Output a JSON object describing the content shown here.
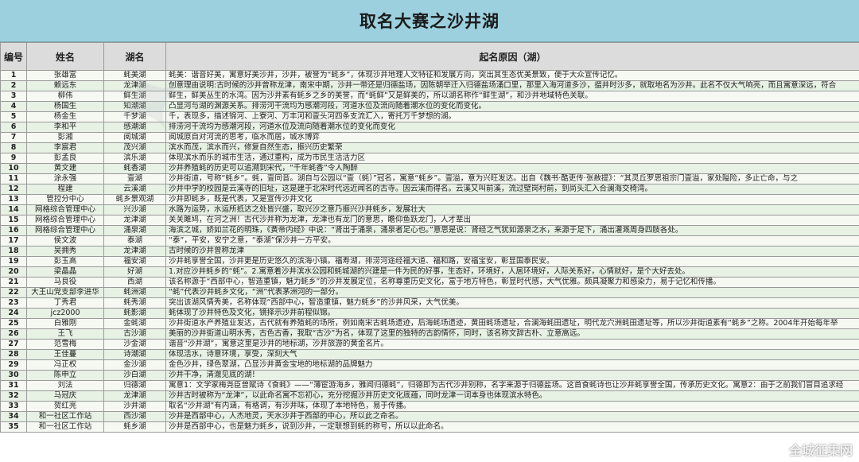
{
  "title": "取名大赛之沙井湖",
  "headers": {
    "no": "编号",
    "name": "姓名",
    "lake": "湖名",
    "reason": "起名原因（湖）"
  },
  "rows": [
    {
      "no": "1",
      "name": "张雄富",
      "lake": "蚝美湖",
      "reason": "蚝美：谐音好美，寓意好美沙井，沙井，被誉为“蚝乡”，体现沙井地理人文特征和发展方向，突出其生态优美景致，便于大众宣传记忆。"
    },
    {
      "no": "2",
      "name": "赖远东",
      "lake": "龙津湖",
      "reason": "创意理由说明:古时候的沙井曾称龙津，南宋中期，沙井一带还是归德盐场，因陈朝举迁入归德盐场涌口里，那里入海河道多沙，搵井时沙多，就取地名为沙井。此名不仅大气响亮，而且寓意深远，符合"
    },
    {
      "no": "3",
      "name": "柳伟",
      "lake": "鲜生湖",
      "reason": "鲜生，鲜美丛生的水湾。因为沙井素有蚝乡之乡的美誉，而“蚝鲜”又是鲜美的，所以湖名称作“鲜生湖”，和沙井地域特色关联。"
    },
    {
      "no": "4",
      "name": "杨国生",
      "lake": "知潮湖",
      "reason": "凸显河与湖的渊源关系。排涝河干流均为感潮河段，河道水位及流向随着潮水位的变化而变化。"
    },
    {
      "no": "5",
      "name": "杨金生",
      "lake": "千梦湖",
      "reason": "千，表现多，描述锦河、上寮河、万丰河和壹头河四条支流汇入，寄托万千梦想的湖。"
    },
    {
      "no": "6",
      "name": "李和平",
      "lake": "感潮湖",
      "reason": "排涝河干流均为感潮河段，河道水位及流向随着潮水位的变化而变化"
    },
    {
      "no": "7",
      "name": "彭湘",
      "lake": "阅城湖",
      "reason": "阅城原自对河流的思考，临水而居，城水博弈"
    },
    {
      "no": "8",
      "name": "李宸君",
      "lake": "茂兴湖",
      "reason": "滨水而茂，滨水而兴，修复自然生态，振兴历史繁荣"
    },
    {
      "no": "9",
      "name": "彭孟良",
      "lake": "滨乐湖",
      "reason": "体现滨水而乐的城市生活，通过重构，成为市民生活活力区"
    },
    {
      "no": "10",
      "name": "黄文建",
      "lake": "蚝香湖",
      "reason": "沙井养殖蚝的历史可以追溯到宋代，“千年蚝香”令人陶醉"
    },
    {
      "no": "11",
      "name": "涂永强",
      "lake": "壹湖",
      "reason": "沙井街道，号称“蚝乡”。蚝，壹同音。湖自与公园以“壹（蚝）”冠名，寓意“蚝乡”。壹溢，意为兴旺发达。出自《魏书·酷吏传·张赦提》：“其灵丘罗思祖宗门壹溢，家处隘险，多止亡命，与之"
    },
    {
      "no": "12",
      "name": "程建",
      "lake": "云溪湖",
      "reason": "沙井中学的校园是云溪寺的旧址，这是建于北宋时代远近闻名的古寺。因云溪而得名。云溪又叫前溪，流过壁岗村前，到尚头汇入合澜海交椅湾。"
    },
    {
      "no": "13",
      "name": "管控分中心",
      "lake": "蚝乡景观湖",
      "reason": "沙井即蚝乡，既是代表，又是宣传沙井文化"
    },
    {
      "no": "14",
      "name": "网格综合管理中心",
      "lake": "兴沙湖",
      "reason": "水路为运势，水运所抵达之处皆兴盛，取兴沙之意乃振兴沙井蚝乡，发展壮大"
    },
    {
      "no": "15",
      "name": "网格综合管理中心",
      "lake": "龙津湖",
      "reason": "关关雎鸠，在河之洲！古代沙井称为龙津，龙津也有龙门的意思，瞻仰鱼跃龙门，人才辈出"
    },
    {
      "no": "16",
      "name": "网格综合管理中心",
      "lake": "涌泉湖",
      "reason": "海滨之城，娇如兰花的明珠，《黄帝内经》中说：“肾出于涌泉，涌泉者足心也。”意思是说：肾经之气犹如源泉之水，来源于足下，涌出灌溉周身四肢各处。"
    },
    {
      "no": "17",
      "name": "侯文波",
      "lake": "泰湖",
      "reason": "“泰”，平安，安宁之意，“泰湖”保沙井一方平安。"
    },
    {
      "no": "18",
      "name": "吴拥秀",
      "lake": "龙津湖",
      "reason": "古时候的沙井曾称龙津"
    },
    {
      "no": "19",
      "name": "彭玉高",
      "lake": "福安湖",
      "reason": "沙井蚝享誉全国，沙井更是历史悠久的滨海小镇。福寿湖，排涝河途经福大道、福和路，安福宝安，彰显国泰民安。"
    },
    {
      "no": "20",
      "name": "梁晶晶",
      "lake": "好湖",
      "reason": "1.对应沙井蚝乡的“蚝”。2.寓意着沙井滨水公园和蚝城湖的兴建是一件为民的好事，生态好，环境好，人居环境好，人际关系好，心情就好，是个大好去处。"
    },
    {
      "no": "21",
      "name": "马良役",
      "lake": "西湖",
      "reason": "该名称源于“西部中心，智造重镇，魅力蚝乡”的沙井发展定位，名称尊重历史文化，富于地方特色，彰显时代感，大气优雅。颇具凝聚力和感染力，易于记忆和传播。"
    },
    {
      "no": "22",
      "name": "大王山党支部李进华",
      "lake": "蚝洲湖",
      "reason": "“蚝”代表沙井蚝乡文化，“洲”代表茅洲河的一部分。"
    },
    {
      "no": "23",
      "name": "丁秀君",
      "lake": "蚝秀湖",
      "reason": "突出该湖风情秀美，名称体现“西部中心，智造重镇，魅力蚝乡”的沙井风采，大气优美。"
    },
    {
      "no": "24",
      "name": "jcz2000",
      "lake": "蚝影湖",
      "reason": "蚝体现了沙井特色及文化，镜择示沙井前程似锦。"
    },
    {
      "no": "25",
      "name": "白雅刚",
      "lake": "金蚝湖",
      "reason": "沙井街道水产养殖业发达，古代就有养殖蚝的场所，例如南宋古蚝场遗迹，后海蚝场遗迹，黄田蚝场遗址，合澜海蚝田遗址，明代龙穴洲蚝田遗址等，所以沙井街道素有“蚝乡”之称。2004年开始每年举"
    },
    {
      "no": "26",
      "name": "王飞",
      "lake": "古沙湖",
      "reason": "美丽的沙井街道山明水秀，古色古香，我取“古沙”为名，体现了这里的独特的古韵情怀，同时，该名称文辞古朴、立意高远。"
    },
    {
      "no": "27",
      "name": "范雪梅",
      "lake": "沙金湖",
      "reason": "谐音“沙井湖”，寓意这里是沙井的地标湖，沙井旅游的黄金名片。"
    },
    {
      "no": "28",
      "name": "王佳蔓",
      "lake": "诗潮湖",
      "reason": "体现活水，诗意环境，享受，深刻大气"
    },
    {
      "no": "29",
      "name": "冯正权",
      "lake": "金沙湖",
      "reason": "金色沙井，绿色翠湖，凸显沙井黄金宝地的地标湖的品牌魅力"
    },
    {
      "no": "30",
      "name": "陈申立",
      "lake": "沙白湖",
      "reason": "沙井干净，清澈见底的湖！"
    },
    {
      "no": "31",
      "name": "刘法",
      "lake": "归德湖",
      "reason": "寓意1：文学家梅尧臣曾赋诗《食蚝》——“薄宦游海乡，雅闻归德蚝”，归德即为古代沙井别称，名字来源于归德盐场。这首食蚝诗也让沙井蚝享誉全国，传承历史文化。寓意2：由于之前我们冒目追求经"
    },
    {
      "no": "32",
      "name": "马冠庆",
      "lake": "龙津湖",
      "reason": "沙井古时被称为“龙津”，以此命名寓不忘初心，充分挖掘沙井历史文化底蕴，同时龙津一词本身也体现滨水特色。"
    },
    {
      "no": "33",
      "name": "贺红亮",
      "lake": "沙井湖",
      "reason": "取名“沙井湖”有内涵，有格调，有沙井味，体现了本地特色，易于传播。"
    },
    {
      "no": "34",
      "name": "和一社区工作站",
      "lake": "西沙湖",
      "reason": "沙井是西部中心，人杰地灵，天水沙井于西部的中心，所以此之命名。"
    },
    {
      "no": "35",
      "name": "和一社区工作站",
      "lake": "蚝乡湖",
      "reason": "沙井是西部中心，也是魅力蚝乡，说到沙井，一定联想到蚝的称号，所以以此命名。"
    }
  ],
  "logo_text": "全城征集网"
}
